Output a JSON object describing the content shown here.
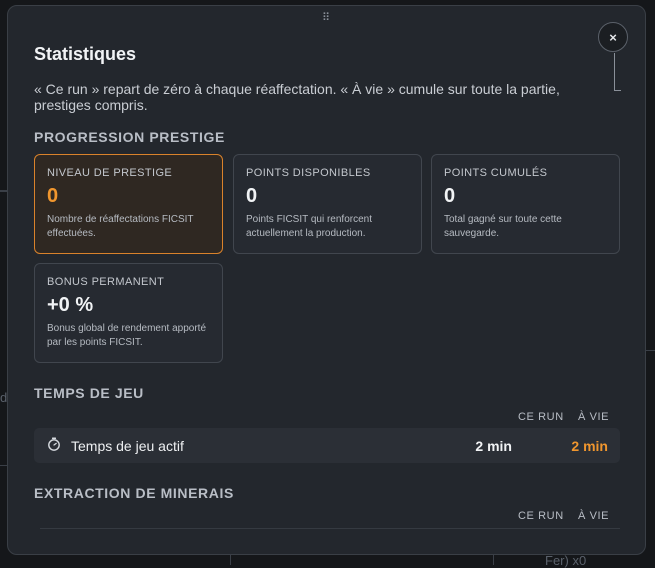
{
  "background": {
    "left_fragment": "de",
    "bottom_fragment": "Fer) x0"
  },
  "modal": {
    "drag_handle": "⠿",
    "close_label": "×",
    "title": "Statistiques",
    "intro": "« Ce run » repart de zéro à chaque réaffectation. « À vie » cumule sur toute la partie, prestiges compris."
  },
  "prestige": {
    "section_title": "PROGRESSION PRESTIGE",
    "cards": [
      {
        "label": "NIVEAU DE PRESTIGE",
        "value": "0",
        "desc": "Nombre de réaffectations FICSIT effectuées.",
        "accent": "#d9822b"
      },
      {
        "label": "POINTS DISPONIBLES",
        "value": "0",
        "desc": "Points FICSIT qui renforcent actuellement la production."
      },
      {
        "label": "POINTS CUMULÉS",
        "value": "0",
        "desc": "Total gagné sur toute cette sauvegarde."
      },
      {
        "label": "BONUS PERMANENT",
        "value": "+0 %",
        "desc": "Bonus global de rendement apporté par les points FICSIT."
      }
    ]
  },
  "playtime": {
    "section_title": "TEMPS DE JEU",
    "col_run": "CE RUN",
    "col_life": "À VIE",
    "rows": [
      {
        "icon": "stopwatch-icon",
        "label": "Temps de jeu actif",
        "run": "2 min",
        "life": "2 min"
      }
    ]
  },
  "minerals": {
    "section_title": "EXTRACTION DE MINERAIS",
    "col_run": "CE RUN",
    "col_life": "À VIE"
  },
  "colors": {
    "accent": "#f0962e",
    "panel": "#23272d",
    "card": "#262a31"
  }
}
